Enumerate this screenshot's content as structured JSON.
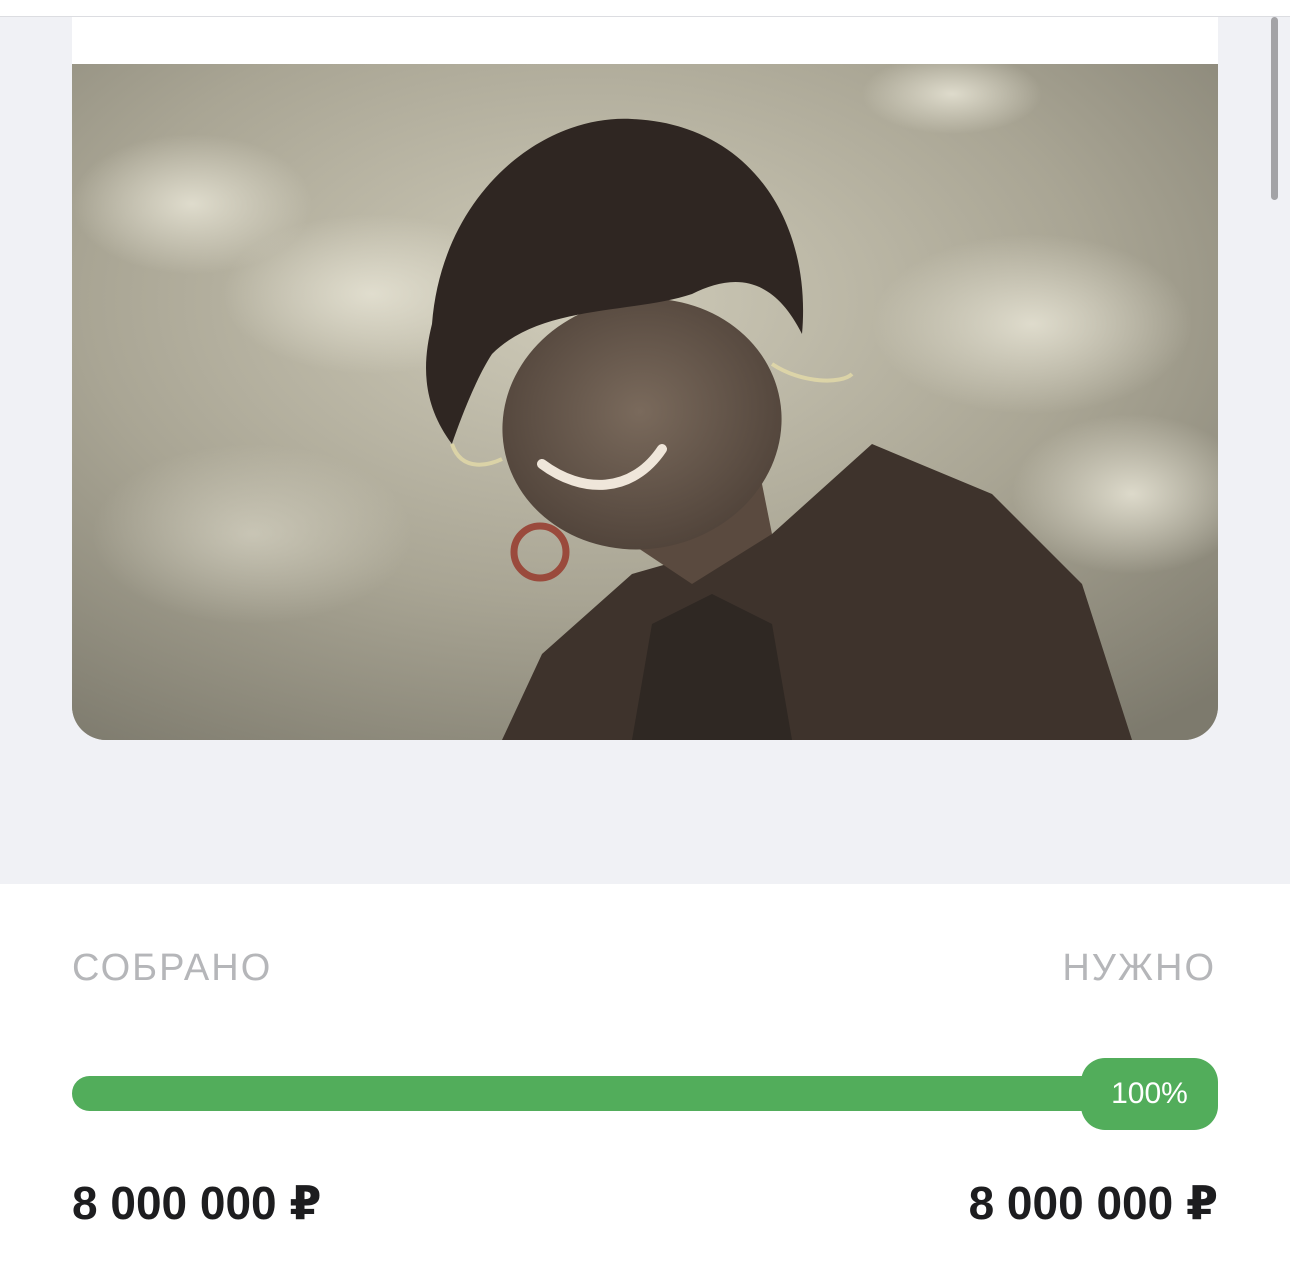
{
  "image": {
    "alt_icon": "photo-woman-smiling"
  },
  "funding": {
    "collected_label": "СОБРАНО",
    "needed_label": "НУЖНО",
    "progress_text": "100%",
    "progress_fraction": 1.0,
    "collected_amount": "8 000 000 ₽",
    "needed_amount": "8 000 000 ₽"
  },
  "colors": {
    "accent_green": "#52ad5b",
    "label_gray": "#b5b6b9",
    "background_gray": "#f0f1f5",
    "text_dark": "#1d1d1f"
  }
}
